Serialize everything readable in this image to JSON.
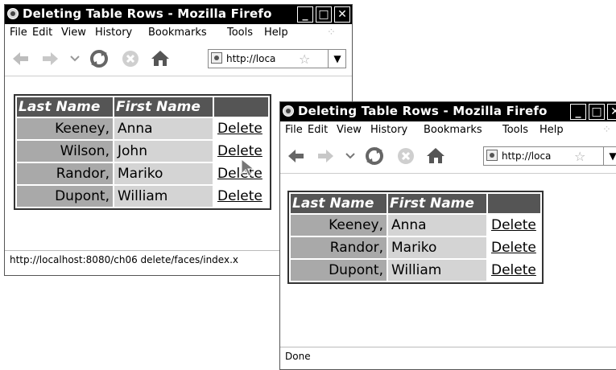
{
  "window1": {
    "title": "Deleting Table Rows - Mozilla Firefo",
    "menu": [
      "File",
      "Edit",
      "View",
      "History",
      "Bookmarks",
      "Tools",
      "Help"
    ],
    "url": "http://loca",
    "table": {
      "headers": [
        "Last Name",
        "First Name",
        ""
      ],
      "rows": [
        {
          "last": "Keeney,",
          "first": "Anna",
          "action": "Delete"
        },
        {
          "last": "Wilson,",
          "first": "John",
          "action": "Delete"
        },
        {
          "last": "Randor,",
          "first": "Mariko",
          "action": "Delete"
        },
        {
          "last": "Dupont,",
          "first": "William",
          "action": "Delete"
        }
      ]
    },
    "status": "http://localhost:8080/ch06 delete/faces/index.x"
  },
  "window2": {
    "title": "Deleting Table Rows - Mozilla Firefo",
    "menu": [
      "File",
      "Edit",
      "View",
      "History",
      "Bookmarks",
      "Tools",
      "Help"
    ],
    "url": "http://loca",
    "table": {
      "headers": [
        "Last Name",
        "First Name",
        ""
      ],
      "rows": [
        {
          "last": "Keeney,",
          "first": "Anna",
          "action": "Delete"
        },
        {
          "last": "Randor,",
          "first": "Mariko",
          "action": "Delete"
        },
        {
          "last": "Dupont,",
          "first": "William",
          "action": "Delete"
        }
      ]
    },
    "status": "Done"
  },
  "colors": {
    "titlebar": "#000000",
    "header_cell": "#555555",
    "last_name_cell": "#a9a9a9",
    "first_name_cell": "#d4d4d4"
  },
  "icons": [
    "firefox-icon",
    "back-arrow-icon",
    "forward-arrow-icon",
    "history-dropdown-icon",
    "reload-icon",
    "stop-icon",
    "home-icon",
    "site-identity-icon",
    "bookmark-star-icon",
    "url-dropdown-icon",
    "minimize-icon",
    "maximize-icon",
    "close-icon",
    "mouse-cursor-icon"
  ]
}
